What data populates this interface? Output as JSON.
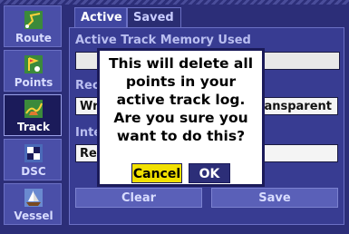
{
  "sidebar": {
    "items": [
      {
        "label": "Route",
        "icon": "route-icon"
      },
      {
        "label": "Points",
        "icon": "points-icon"
      },
      {
        "label": "Track",
        "icon": "track-icon",
        "active": true
      },
      {
        "label": "DSC",
        "icon": "dsc-icon"
      },
      {
        "label": "Vessel",
        "icon": "vessel-icon"
      }
    ]
  },
  "tabs": {
    "active_label": "Active",
    "saved_label": "Saved"
  },
  "panel": {
    "memory_label": "Active Track Memory Used",
    "record_label": "Rec",
    "record_value_left": "Wra",
    "record_value_right": "ansparent",
    "interval_label": "Inte",
    "interval_value": "Res",
    "clear_label": "Clear",
    "save_label": "Save"
  },
  "dialog": {
    "message": "This will delete all points in your active track log.  Are you sure you want to do this?",
    "cancel_label": "Cancel",
    "ok_label": "OK"
  },
  "colors": {
    "background": "#2c2e78",
    "accent_highlight": "#f2e000"
  }
}
